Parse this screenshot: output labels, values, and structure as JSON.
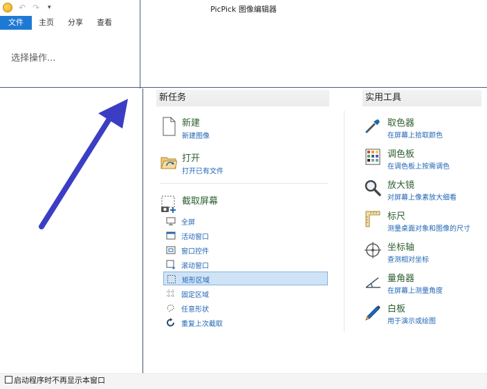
{
  "window": {
    "title": "PicPick 图像编辑器"
  },
  "quick_access": {
    "undo": "↶",
    "redo": "↷",
    "menu": "▾"
  },
  "ribbon": {
    "tabs": [
      {
        "label": "文件",
        "active": true
      },
      {
        "label": "主页",
        "active": false
      },
      {
        "label": "分享",
        "active": false
      },
      {
        "label": "查看",
        "active": false
      }
    ],
    "hint": "选择操作..."
  },
  "new_task": {
    "header": "新任务",
    "items": [
      {
        "title": "新建",
        "desc": "新建图像",
        "icon": "new-file-icon"
      },
      {
        "title": "打开",
        "desc": "打开已有文件",
        "icon": "open-folder-icon"
      },
      {
        "title": "截取屏幕",
        "icon": "screen-capture-icon"
      }
    ],
    "capture_options": [
      {
        "label": "全屏",
        "icon": "monitor-icon"
      },
      {
        "label": "活动窗口",
        "icon": "window-icon"
      },
      {
        "label": "窗口控件",
        "icon": "window-control-icon"
      },
      {
        "label": "滚动窗口",
        "icon": "scroll-window-icon"
      },
      {
        "label": "矩形区域",
        "icon": "rectangle-region-icon",
        "selected": true
      },
      {
        "label": "固定区域",
        "icon": "fixed-region-icon"
      },
      {
        "label": "任意形状",
        "icon": "freehand-icon"
      },
      {
        "label": "重复上次截取",
        "icon": "repeat-icon"
      }
    ]
  },
  "tools": {
    "header": "实用工具",
    "items": [
      {
        "title": "取色器",
        "desc": "在屏幕上拾取颜色",
        "icon": "eyedropper-icon"
      },
      {
        "title": "调色板",
        "desc": "在调色板上按需调色",
        "icon": "palette-icon"
      },
      {
        "title": "放大镜",
        "desc": "对屏幕上像素放大细看",
        "icon": "magnifier-icon"
      },
      {
        "title": "标尺",
        "desc": "测量桌面对象和图像的尺寸",
        "icon": "ruler-icon"
      },
      {
        "title": "坐标轴",
        "desc": "查测相对坐标",
        "icon": "crosshair-icon"
      },
      {
        "title": "量角器",
        "desc": "在屏幕上测量角度",
        "icon": "protractor-icon"
      },
      {
        "title": "白板",
        "desc": "用于演示或绘图",
        "icon": "whiteboard-pen-icon"
      }
    ]
  },
  "footer": {
    "startup_label": "启动程序时不再显示本窗口",
    "checked": false
  },
  "colors": {
    "accent": "#1e79d4",
    "title_green": "#2c5e2e",
    "link_blue": "#2166b4",
    "arrow": "#3b3ec4",
    "selection": "#cfe3f6"
  }
}
